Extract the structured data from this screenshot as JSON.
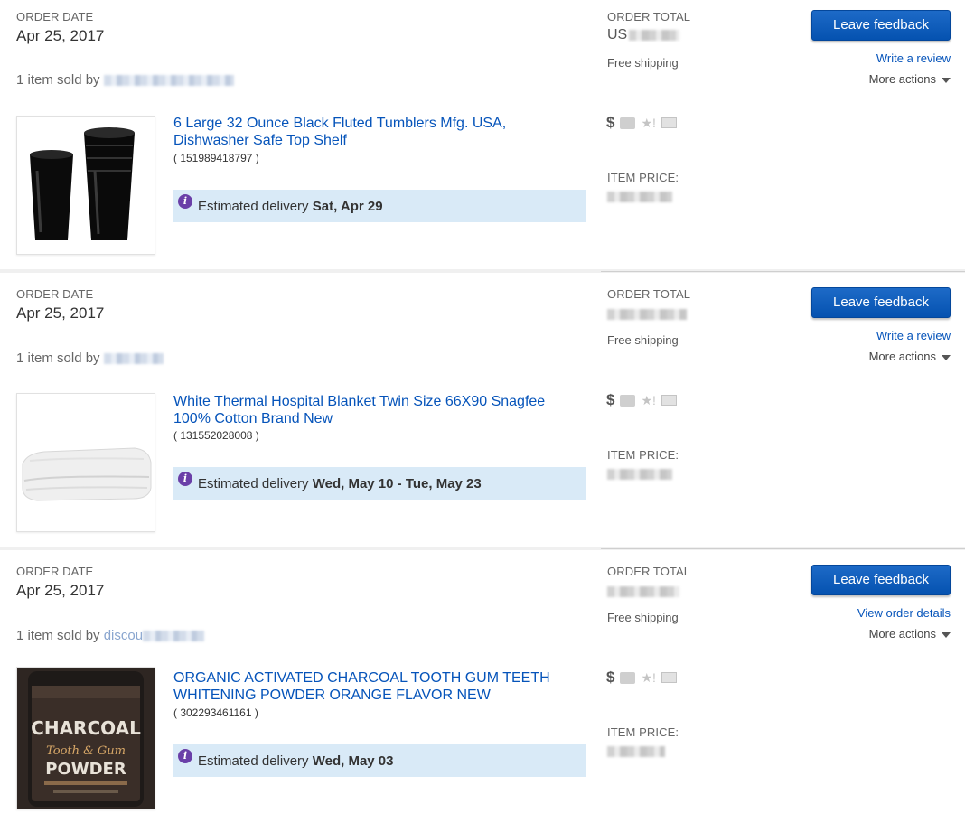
{
  "labels": {
    "order_date": "ORDER DATE",
    "order_total": "ORDER TOTAL",
    "item_price": "ITEM PRICE:",
    "sold_by": "1 item sold by",
    "free_shipping": "Free shipping",
    "leave_feedback": "Leave feedback",
    "more_actions": "More actions",
    "estimated_delivery": "Estimated delivery",
    "currency_icon": "$"
  },
  "orders": [
    {
      "date": "Apr 25, 2017",
      "total_partial": "US",
      "secondary_link": "Write a review",
      "item": {
        "title_line1": "6 Large 32 Ounce Black Fluted Tumblers Mfg. USA,",
        "title_line2": "Dishwasher Safe Top Shelf",
        "item_number": "( 151989418797 )",
        "delivery": "Sat, Apr 29"
      }
    },
    {
      "date": "Apr 25, 2017",
      "total_partial": "",
      "secondary_link": "Write a review",
      "item": {
        "title_line1": "White Thermal Hospital Blanket Twin Size 66X90 Snagfee",
        "title_line2": "100% Cotton Brand New",
        "item_number": "( 131552028008 )",
        "delivery": "Wed, May 10 - Tue, May 23"
      }
    },
    {
      "date": "Apr 25, 2017",
      "total_partial": "",
      "secondary_link": "View order details",
      "seller_partial": "discou",
      "item": {
        "title_line1": "ORGANIC ACTIVATED CHARCOAL TOOTH GUM TEETH",
        "title_line2": "WHITENING POWDER ORANGE FLAVOR NEW",
        "item_number": "( 302293461161 )",
        "delivery": "Wed, May 03",
        "product_label_line1": "CHARCOAL",
        "product_label_line2": "Tooth & Gum",
        "product_label_line3": "POWDER"
      }
    }
  ],
  "colors": {
    "link": "#0654ba",
    "button": "#0654ba",
    "delivery_bg": "#d9eaf7",
    "info_icon": "#6a3fa8"
  }
}
